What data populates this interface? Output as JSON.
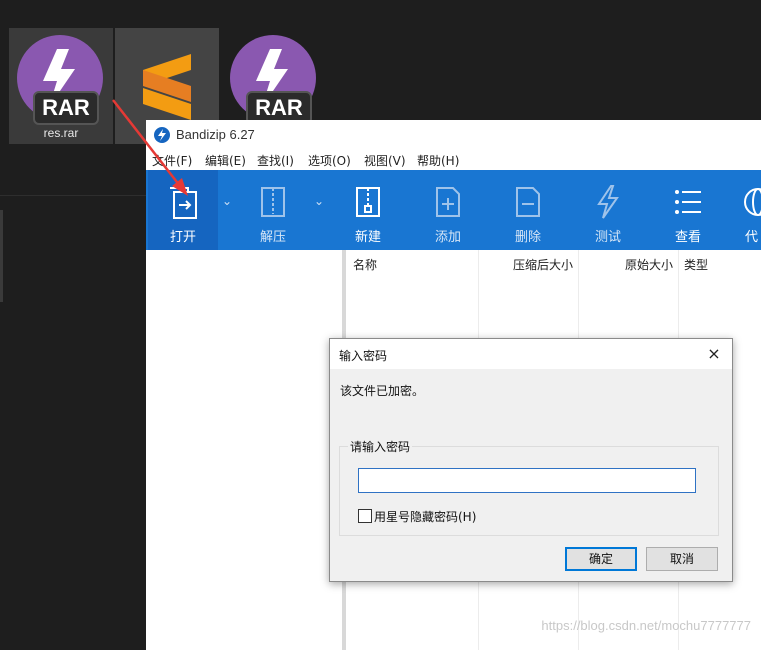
{
  "desktop": {
    "icons": [
      {
        "label": "res.rar",
        "badge": "RAR"
      },
      {
        "label": "",
        "badge": ""
      },
      {
        "label": "",
        "badge": "RAR"
      }
    ]
  },
  "app": {
    "title": "Bandizip 6.27",
    "menu": [
      "文件(F)",
      "编辑(E)",
      "查找(I)",
      "选项(O)",
      "视图(V)",
      "帮助(H)"
    ],
    "toolbar": [
      "打开",
      "解压",
      "新建",
      "添加",
      "删除",
      "测试",
      "查看",
      "代"
    ],
    "columns": [
      "名称",
      "压缩后大小",
      "原始大小",
      "类型"
    ]
  },
  "dialog": {
    "title": "输入密码",
    "close_icon": "×",
    "message": "该文件已加密。",
    "group_label": "请输入密码",
    "password_value": "",
    "checkbox_label": "用星号隐藏密码(H)",
    "ok_label": "确定",
    "cancel_label": "取消"
  },
  "watermark": "https://blog.csdn.net/mochu7777777",
  "colors": {
    "toolbar": "#1976d2",
    "rar_icon": "#8a58b0",
    "sublime": "#f39c12",
    "arrow": "#e53935"
  }
}
